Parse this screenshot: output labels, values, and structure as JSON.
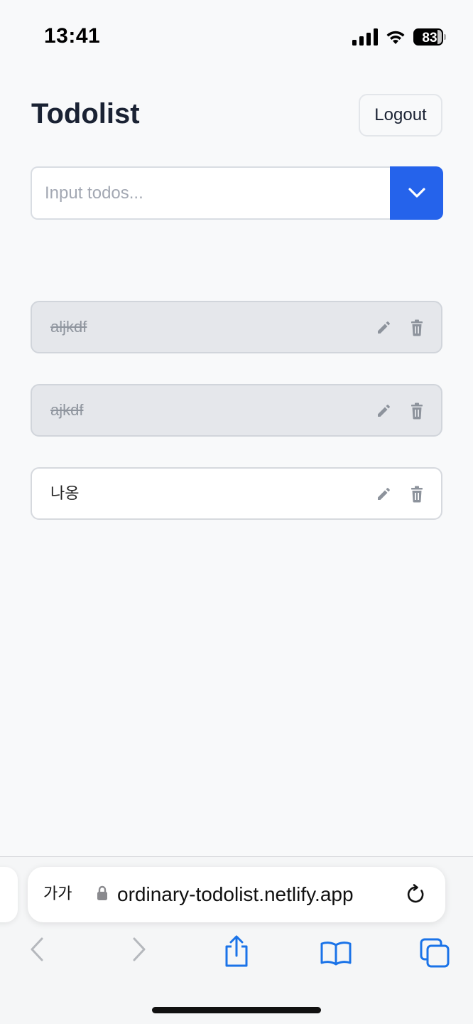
{
  "status_bar": {
    "time": "13:41",
    "battery_level": "83",
    "battery_fraction": 0.83
  },
  "header": {
    "title": "Todolist",
    "logout_label": "Logout"
  },
  "todo_form": {
    "input_value": "",
    "placeholder": "Input todos...",
    "submit_icon": "chevron-down-icon"
  },
  "todos": [
    {
      "text": "aljkdf",
      "done": true
    },
    {
      "text": "ajkdf",
      "done": true
    },
    {
      "text": "나옹",
      "done": false
    }
  ],
  "todo_actions": {
    "edit_icon": "pencil-icon",
    "delete_icon": "trash-icon"
  },
  "browser": {
    "text_size_label": "가가",
    "url": "ordinary-todolist.netlify.app",
    "nav_icons": [
      "back-icon",
      "forward-icon",
      "share-icon",
      "bookmarks-icon",
      "tabs-icon"
    ]
  },
  "colors": {
    "accent": "#2563eb",
    "background": "#f8f9fa",
    "done_item_bg": "#e5e7eb",
    "browser_blue": "#1a73e8"
  }
}
